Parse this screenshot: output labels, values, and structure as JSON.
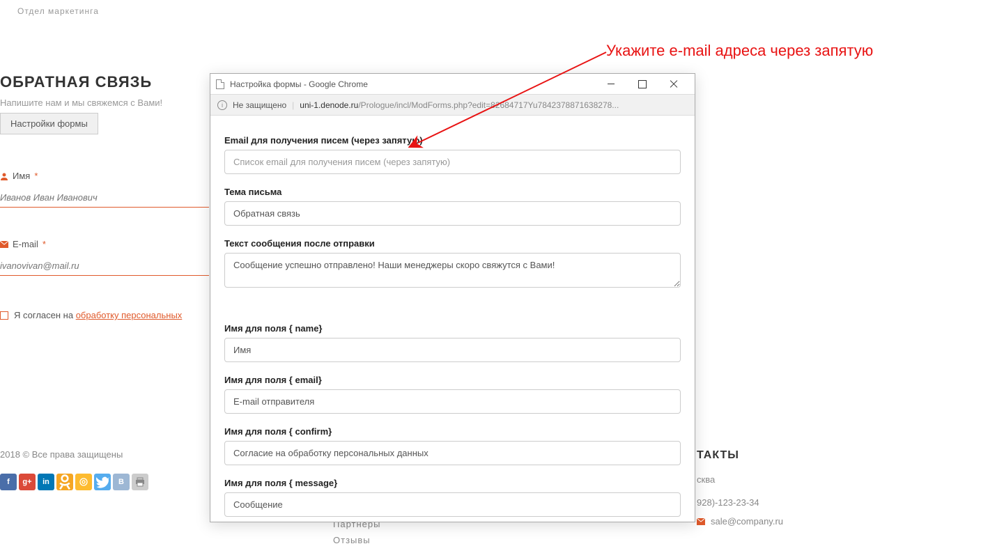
{
  "bg": {
    "dept": "Отдел маркетинга",
    "title": "ОБРАТНАЯ СВЯЗЬ",
    "subtitle": "Напишите нам и мы свяжемся с Вами!",
    "settings_btn": "Настройки формы",
    "name_label": "Имя",
    "name_placeholder": "Иванов Иван Иванович",
    "email_label": "E-mail",
    "email_placeholder": "ivanovivan@mail.ru",
    "consent_prefix": "Я согласен на ",
    "consent_link": "обработку персональных",
    "copyright": "2018 © Все права защищены",
    "contacts_title": "ТАКТЫ",
    "city": "сква",
    "phone": "928)-123-23-34",
    "mail": "sale@company.ru",
    "footer_links": [
      "Партнеры",
      "Отзывы"
    ]
  },
  "popup": {
    "window_title": "Настройка формы - Google Chrome",
    "security": "Не защищено",
    "url_host": "uni-1.denode.ru",
    "url_path": "/Prologue/incl/ModForms.php?edit=82684717Yu7842378871638278...",
    "fields": {
      "email_recv": {
        "label": "Email для получения писем (через запятую)",
        "placeholder": "Список email для получения писем (через запятую)",
        "value": ""
      },
      "subject": {
        "label": "Тема письма",
        "value": "Обратная связь"
      },
      "after_send": {
        "label": "Текст сообщения после отправки",
        "value": "Сообщение успешно отправлено! Наши менеджеры скоро свяжутся с Вами!"
      },
      "name_field": {
        "label": "Имя для поля { name}",
        "value": "Имя"
      },
      "email_field": {
        "label": "Имя для поля { email}",
        "value": "E-mail отправителя"
      },
      "confirm_field": {
        "label": "Имя для поля { confirm}",
        "value": "Согласие на обработку персональных данных"
      },
      "message_field": {
        "label": "Имя для поля { message}",
        "value": "Сообщение"
      }
    }
  },
  "annotation": "Укажите e-mail адреса через запятую"
}
